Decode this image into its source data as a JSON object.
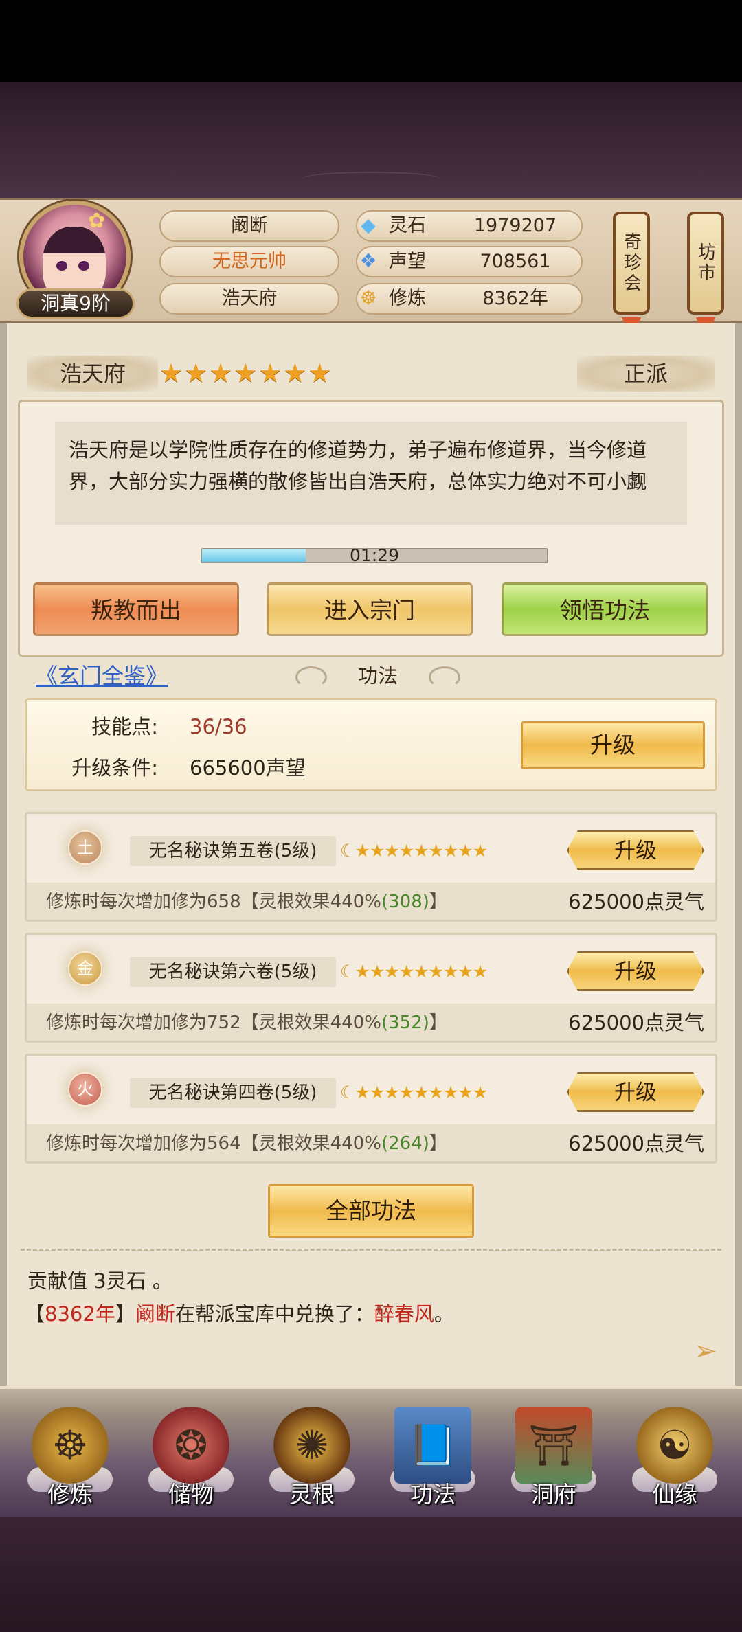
{
  "header": {
    "rank": "洞真9阶",
    "player_name": "阚断",
    "title": "无思元帅",
    "sect": "浩天府",
    "resources": [
      {
        "icon": "spirit-stone-icon",
        "label": "灵石",
        "value": "1979207"
      },
      {
        "icon": "prestige-icon",
        "label": "声望",
        "value": "708561"
      },
      {
        "icon": "cultivation-icon",
        "label": "修炼",
        "value": "8362年"
      }
    ],
    "lanterns": [
      "奇珍会",
      "坊市"
    ]
  },
  "sect_info": {
    "name": "浩天府",
    "stars": "★★★★★★★",
    "alignment": "正派",
    "description": "浩天府是以学院性质存在的修道势力，弟子遍布修道界，当今修道界，大部分实力强横的散修皆出自浩天府，总体实力绝对不可小觑",
    "timer": "01:29",
    "timer_progress": 0.3,
    "buttons": {
      "leave": "叛教而出",
      "enter": "进入宗门",
      "comprehend": "领悟功法"
    }
  },
  "gongfa": {
    "link": "《玄门全鉴》",
    "section_title": "功法",
    "skill_points_label": "技能点:",
    "skill_points_value": "36/36",
    "upgrade_cond_label": "升级条件:",
    "upgrade_cond_value": "665600声望",
    "upgrade_button": "升级",
    "techniques": [
      {
        "element": "土",
        "name": "无名秘诀第五卷(5级)",
        "stars": "★★★★★★★★★",
        "upgrade": "升级",
        "desc_prefix": "修炼时每次增加修为658【灵根效果440%",
        "desc_bonus": "(308)",
        "desc_suffix": "】",
        "cost": "625000点灵气"
      },
      {
        "element": "金",
        "name": "无名秘诀第六卷(5级)",
        "stars": "★★★★★★★★★",
        "upgrade": "升级",
        "desc_prefix": "修炼时每次增加修为752【灵根效果440%",
        "desc_bonus": "(352)",
        "desc_suffix": "】",
        "cost": "625000点灵气"
      },
      {
        "element": "火",
        "name": "无名秘诀第四卷(5级)",
        "stars": "★★★★★★★★★",
        "upgrade": "升级",
        "desc_prefix": "修炼时每次增加修为564【灵根效果440%",
        "desc_bonus": "(264)",
        "desc_suffix": "】",
        "cost": "625000点灵气"
      }
    ],
    "all_button": "全部功法"
  },
  "log": {
    "line1": "贡献值 3灵石 。",
    "line2_open": "【",
    "line2_year": "8362年",
    "line2_close": "】",
    "line2_name": "阚断",
    "line2_mid": "在帮派宝库中兑换了：",
    "line2_item": "醉春风",
    "line2_end": "。"
  },
  "nav": [
    {
      "label": "修炼",
      "icon": "meditate-icon"
    },
    {
      "label": "储物",
      "icon": "bag-icon"
    },
    {
      "label": "灵根",
      "icon": "spirit-root-icon"
    },
    {
      "label": "功法",
      "icon": "book-icon"
    },
    {
      "label": "洞府",
      "icon": "cave-house-icon"
    },
    {
      "label": "仙缘",
      "icon": "gourd-icon"
    }
  ],
  "colors": {
    "accent_gold": "#f0bb4c",
    "danger_red": "#c2271d",
    "link_blue": "#3261c4",
    "bonus_green": "#49852a"
  }
}
